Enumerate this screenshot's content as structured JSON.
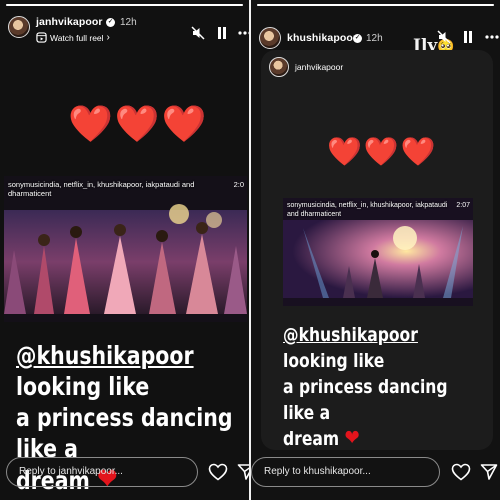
{
  "left_story": {
    "progress": 1.0,
    "username": "janhvikapoor",
    "time": "12h",
    "watch_label": "Watch full reel",
    "watch_chevron": "›",
    "icons": [
      "mute-icon",
      "pause-icon",
      "more-icon"
    ],
    "hearts": [
      "❤️",
      "❤️",
      "❤️"
    ],
    "video": {
      "tags": "sonymusicindia, netflix_in, khushikapoor, iakpataudi and dharmaticent",
      "time": "2:0"
    },
    "caption": {
      "mention": "@khushikapoor",
      "line1_rest": " looking like",
      "line2": "a princess dancing like a",
      "line3": "dream",
      "heart": "❤"
    },
    "reply_placeholder": "Reply to janhvikapoor..."
  },
  "right_story": {
    "progress": 1.0,
    "username": "khushikapoor",
    "time": "12h",
    "sticker_text": "Ily",
    "sticker_emoji": "🥺",
    "icons": [
      "mute-icon",
      "pause-icon",
      "more-icon"
    ],
    "shared_username": "janhvikapoor",
    "hearts": [
      "❤️",
      "❤️",
      "❤️"
    ],
    "video": {
      "tags": "sonymusicindia, netflix_in, khushikapoor, iakpataudi and dharmaticent",
      "time": "2:07"
    },
    "caption": {
      "mention": "@khushikapoor",
      "line1_rest": " looking like",
      "line2": "a princess dancing like a",
      "line3": "dream",
      "heart": "❤"
    },
    "reply_placeholder": "Reply to khushikapoor..."
  },
  "colors": {
    "heart_red": "#e3141c",
    "background": "#111111",
    "divider": "#f2f2f2"
  }
}
